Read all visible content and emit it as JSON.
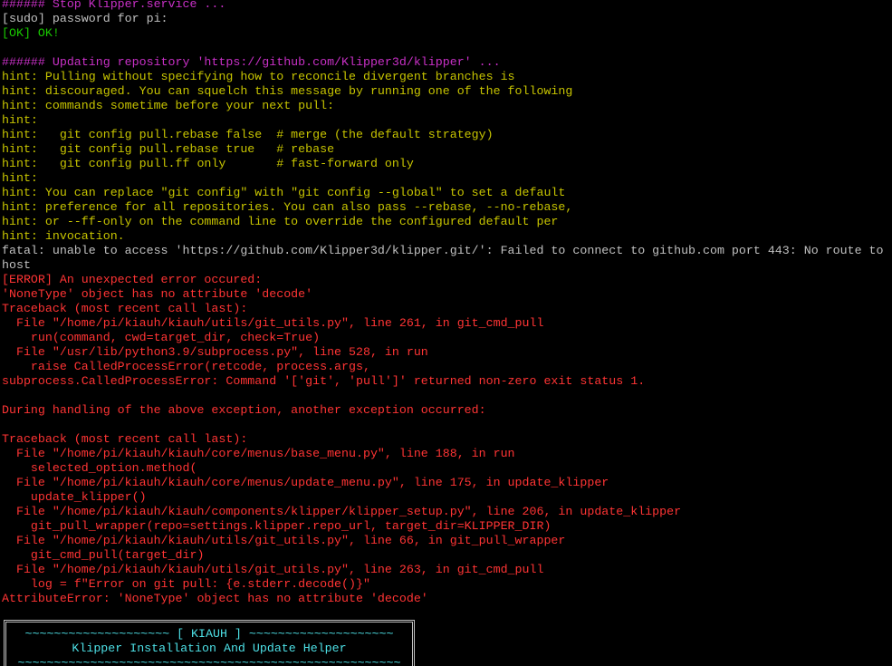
{
  "window": {
    "type": "terminal"
  },
  "colors": {
    "background": "#000000",
    "default_text": "#c0c0c0",
    "ok": "#19cb00",
    "heading": "#c930c7",
    "hint": "#c7c400",
    "error": "#ff3434",
    "banner": "#4de0e6"
  },
  "lines": [
    {
      "text": "###### Stop Klipper.service ...",
      "color": "magenta"
    },
    {
      "text": "[sudo] password for pi:",
      "color": "white"
    },
    {
      "text": "[OK] OK!",
      "color": "green"
    },
    {
      "text": "",
      "color": "white"
    },
    {
      "text": "###### Updating repository 'https://github.com/Klipper3d/klipper' ...",
      "color": "magenta"
    },
    {
      "text": "hint: Pulling without specifying how to reconcile divergent branches is",
      "color": "yellow"
    },
    {
      "text": "hint: discouraged. You can squelch this message by running one of the following",
      "color": "yellow"
    },
    {
      "text": "hint: commands sometime before your next pull:",
      "color": "yellow"
    },
    {
      "text": "hint:",
      "color": "yellow"
    },
    {
      "text": "hint:   git config pull.rebase false  # merge (the default strategy)",
      "color": "yellow"
    },
    {
      "text": "hint:   git config pull.rebase true   # rebase",
      "color": "yellow"
    },
    {
      "text": "hint:   git config pull.ff only       # fast-forward only",
      "color": "yellow"
    },
    {
      "text": "hint:",
      "color": "yellow"
    },
    {
      "text": "hint: You can replace \"git config\" with \"git config --global\" to set a default",
      "color": "yellow"
    },
    {
      "text": "hint: preference for all repositories. You can also pass --rebase, --no-rebase,",
      "color": "yellow"
    },
    {
      "text": "hint: or --ff-only on the command line to override the configured default per",
      "color": "yellow"
    },
    {
      "text": "hint: invocation.",
      "color": "yellow"
    },
    {
      "text": "fatal: unable to access 'https://github.com/Klipper3d/klipper.git/': Failed to connect to github.com port 443: No route to",
      "color": "white"
    },
    {
      "text": "host",
      "color": "white"
    },
    {
      "text": "[ERROR] An unexpected error occured:",
      "color": "red"
    },
    {
      "text": "'NoneType' object has no attribute 'decode'",
      "color": "red"
    },
    {
      "text": "Traceback (most recent call last):",
      "color": "red"
    },
    {
      "text": "  File \"/home/pi/kiauh/kiauh/utils/git_utils.py\", line 261, in git_cmd_pull",
      "color": "red"
    },
    {
      "text": "    run(command, cwd=target_dir, check=True)",
      "color": "red"
    },
    {
      "text": "  File \"/usr/lib/python3.9/subprocess.py\", line 528, in run",
      "color": "red"
    },
    {
      "text": "    raise CalledProcessError(retcode, process.args,",
      "color": "red"
    },
    {
      "text": "subprocess.CalledProcessError: Command '['git', 'pull']' returned non-zero exit status 1.",
      "color": "red"
    },
    {
      "text": "",
      "color": "red"
    },
    {
      "text": "During handling of the above exception, another exception occurred:",
      "color": "red"
    },
    {
      "text": "",
      "color": "red"
    },
    {
      "text": "Traceback (most recent call last):",
      "color": "red"
    },
    {
      "text": "  File \"/home/pi/kiauh/kiauh/core/menus/base_menu.py\", line 188, in run",
      "color": "red"
    },
    {
      "text": "    selected_option.method(",
      "color": "red"
    },
    {
      "text": "  File \"/home/pi/kiauh/kiauh/core/menus/update_menu.py\", line 175, in update_klipper",
      "color": "red"
    },
    {
      "text": "    update_klipper()",
      "color": "red"
    },
    {
      "text": "  File \"/home/pi/kiauh/kiauh/components/klipper/klipper_setup.py\", line 206, in update_klipper",
      "color": "red"
    },
    {
      "text": "    git_pull_wrapper(repo=settings.klipper.repo_url, target_dir=KLIPPER_DIR)",
      "color": "red"
    },
    {
      "text": "  File \"/home/pi/kiauh/kiauh/utils/git_utils.py\", line 66, in git_pull_wrapper",
      "color": "red"
    },
    {
      "text": "    git_cmd_pull(target_dir)",
      "color": "red"
    },
    {
      "text": "  File \"/home/pi/kiauh/kiauh/utils/git_utils.py\", line 263, in git_cmd_pull",
      "color": "red"
    },
    {
      "text": "    log = f\"Error on git pull: {e.stderr.decode()}\"",
      "color": "red"
    },
    {
      "text": "AttributeError: 'NoneType' object has no attribute 'decode'",
      "color": "red"
    }
  ],
  "banner": {
    "top": "~~~~~~~~~~~~~~~~~~~~ [ KIAUH ] ~~~~~~~~~~~~~~~~~~~~",
    "title": "Klipper Installation And Update Helper",
    "bottom": "~~~~~~~~~~~~~~~~~~~~~~~~~~~~~~~~~~~~~~~~~~~~~~~~~~~~~"
  }
}
